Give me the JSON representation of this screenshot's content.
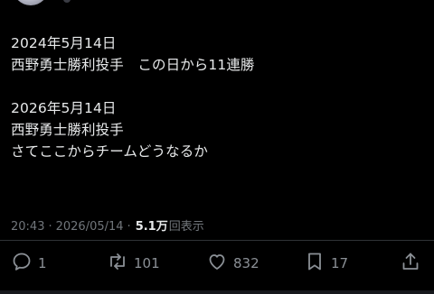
{
  "post": {
    "lines": [
      "2024年5月14日",
      "西野勇士勝利投手　この日から11連勝",
      "",
      "2026年5月14日",
      "西野勇士勝利投手",
      "さてここからチームどうなるか"
    ],
    "time": "20:43",
    "date": "2026/05/14",
    "views_count": "5.1万",
    "views_label": "回表示",
    "separator": "·"
  },
  "actions": {
    "reply_count": "1",
    "repost_count": "101",
    "like_count": "832",
    "bookmark_count": "17"
  },
  "icons": {
    "reply": "reply-icon",
    "repost": "repost-icon",
    "like": "heart-icon",
    "bookmark": "bookmark-icon",
    "share": "share-icon"
  },
  "colors": {
    "background": "#000000",
    "text": "#e7e9ea",
    "muted": "#71767b"
  }
}
